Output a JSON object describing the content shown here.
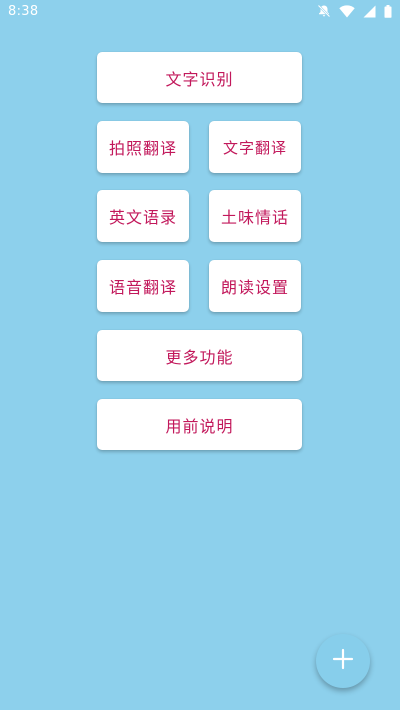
{
  "status_bar": {
    "time": "8:38",
    "icons": [
      "notifications-off-icon",
      "wifi-icon",
      "signal-icon",
      "battery-icon"
    ]
  },
  "buttons": {
    "text_recognition": "文字识别",
    "photo_translate": "拍照翻译",
    "text_translate": "文字翻译",
    "english_quotes": "英文语录",
    "cheesy_lines": "土味情话",
    "voice_translate": "语音翻译",
    "read_settings": "朗读设置",
    "more_features": "更多功能",
    "instructions": "用前说明"
  },
  "fab": {
    "icon": "plus-icon"
  },
  "colors": {
    "background": "#8dd0ec",
    "button_text": "#c2185b",
    "button_bg": "#ffffff",
    "fab_bg": "#87ceeb"
  }
}
